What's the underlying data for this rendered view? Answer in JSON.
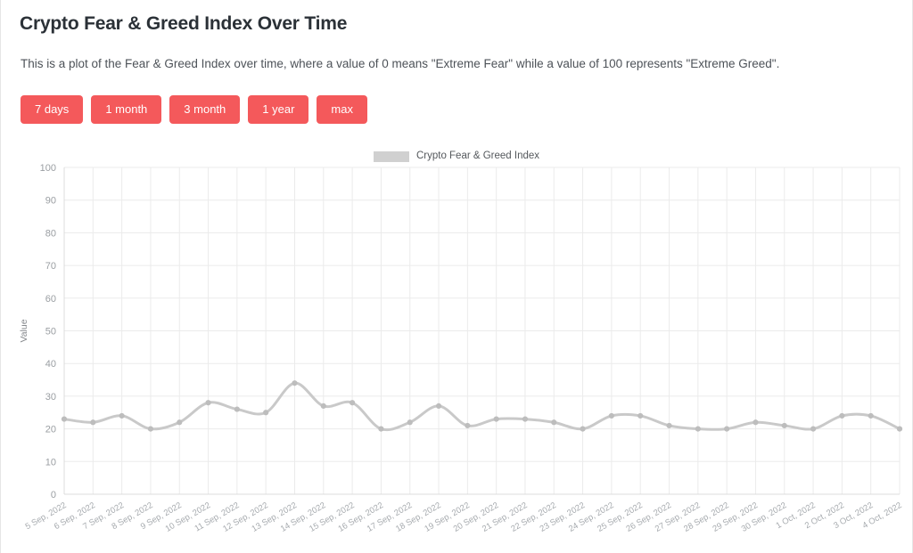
{
  "header": {
    "title": "Crypto Fear & Greed Index Over Time",
    "description": "This is a plot of the Fear & Greed Index over time, where a value of 0 means \"Extreme Fear\" while a value of 100 represents \"Extreme Greed\"."
  },
  "range_buttons": [
    {
      "label": "7 days"
    },
    {
      "label": "1 month"
    },
    {
      "label": "3 month"
    },
    {
      "label": "1 year"
    },
    {
      "label": "max"
    }
  ],
  "colors": {
    "button": "#f4595b",
    "line": "#c9c9c9",
    "grid": "#ebebeb",
    "text": "#2b3137"
  },
  "chart_data": {
    "type": "line",
    "title": "",
    "xlabel": "",
    "ylabel": "Value",
    "ylim": [
      0,
      100
    ],
    "yticks": [
      0,
      10,
      20,
      30,
      40,
      50,
      60,
      70,
      80,
      90,
      100
    ],
    "grid": true,
    "legend_position": "top-center",
    "legend": [
      "Crypto Fear & Greed Index"
    ],
    "series_name": "Crypto Fear & Greed Index",
    "categories": [
      "5 Sep, 2022",
      "6 Sep, 2022",
      "7 Sep, 2022",
      "8 Sep, 2022",
      "9 Sep, 2022",
      "10 Sep, 2022",
      "11 Sep, 2022",
      "12 Sep, 2022",
      "13 Sep, 2022",
      "14 Sep, 2022",
      "15 Sep, 2022",
      "16 Sep, 2022",
      "17 Sep, 2022",
      "18 Sep, 2022",
      "19 Sep, 2022",
      "20 Sep, 2022",
      "21 Sep, 2022",
      "22 Sep, 2022",
      "23 Sep, 2022",
      "24 Sep, 2022",
      "25 Sep, 2022",
      "26 Sep, 2022",
      "27 Sep, 2022",
      "28 Sep, 2022",
      "29 Sep, 2022",
      "30 Sep, 2022",
      "1 Oct, 2022",
      "2 Oct, 2022",
      "3 Oct, 2022",
      "4 Oct, 2022"
    ],
    "values": [
      23,
      22,
      24,
      20,
      22,
      28,
      26,
      25,
      34,
      27,
      28,
      20,
      22,
      27,
      21,
      23,
      23,
      22,
      20,
      24,
      24,
      21,
      20,
      20,
      22,
      21,
      20,
      24,
      24,
      20
    ]
  }
}
